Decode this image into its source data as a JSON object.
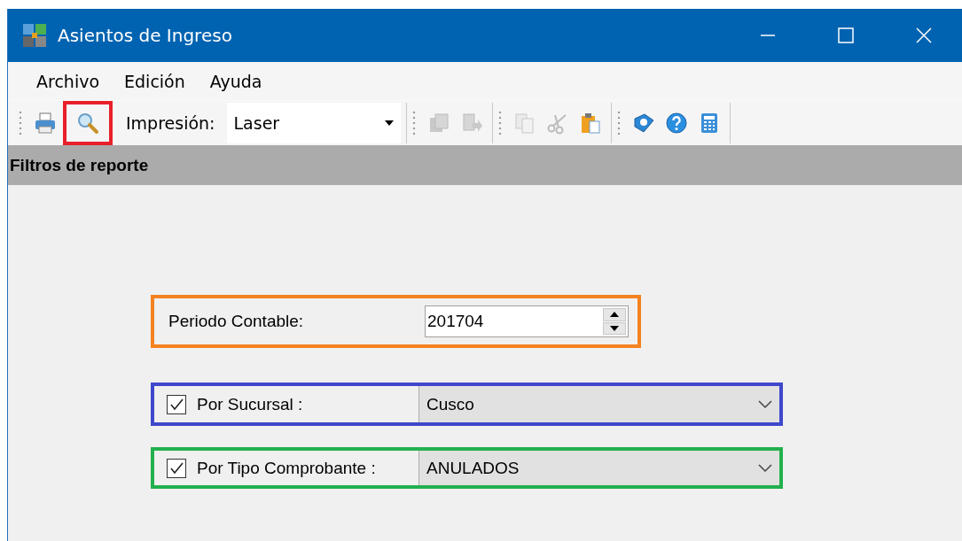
{
  "window": {
    "title": "Asientos de Ingreso"
  },
  "menu": [
    {
      "label": "Archivo"
    },
    {
      "label": "Edición"
    },
    {
      "label": "Ayuda"
    }
  ],
  "toolbar": {
    "groups": [
      {
        "buttons": [
          {
            "disabled": false,
            "highlighted": false
          },
          {
            "disabled": false,
            "highlighted": true
          }
        ],
        "label": "Impresión:",
        "combo_value": "Laser"
      },
      {
        "buttons": [
          {
            "disabled": true,
            "highlighted": false
          },
          {
            "disabled": true,
            "highlighted": false
          }
        ]
      },
      {
        "buttons": [
          {
            "disabled": true,
            "highlighted": false
          },
          {
            "disabled": true,
            "highlighted": false
          },
          {
            "disabled": false,
            "highlighted": false
          }
        ]
      },
      {
        "buttons": [
          {
            "disabled": false,
            "highlighted": false
          },
          {
            "disabled": false,
            "highlighted": false
          },
          {
            "disabled": false,
            "highlighted": false
          }
        ]
      }
    ]
  },
  "section_header": "Filtros de reporte",
  "filters": [
    {
      "kind": "spinner",
      "label": "Periodo Contable:",
      "value": "201704",
      "color": "#f58220"
    },
    {
      "kind": "combo",
      "label": "Por Sucursal :",
      "checked": true,
      "value": "Cusco",
      "color": "#3f48cc"
    },
    {
      "kind": "combo",
      "label": "Por Tipo Comprobante :",
      "checked": true,
      "value": "ANULADOS",
      "color": "#22b14c"
    }
  ]
}
